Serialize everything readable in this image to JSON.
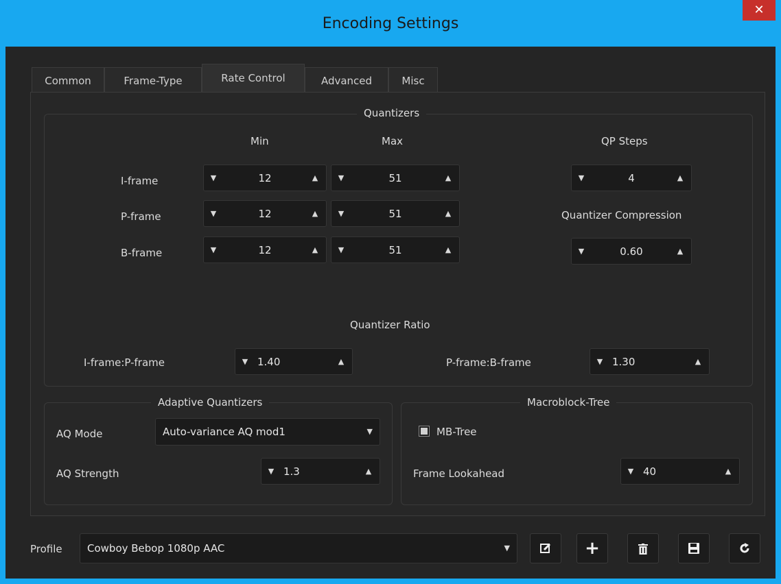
{
  "window": {
    "title": "Encoding Settings",
    "close_glyph": "✕"
  },
  "tabs": [
    {
      "label": "Common"
    },
    {
      "label": "Frame-Type"
    },
    {
      "label": "Rate Control",
      "active": true
    },
    {
      "label": "Advanced"
    },
    {
      "label": "Misc"
    }
  ],
  "quantizers": {
    "title": "Quantizers",
    "col_min": "Min",
    "col_max": "Max",
    "rows": [
      {
        "label": "I-frame",
        "min": "12",
        "max": "51"
      },
      {
        "label": "P-frame",
        "min": "12",
        "max": "51"
      },
      {
        "label": "B-frame",
        "min": "12",
        "max": "51"
      }
    ],
    "qp_steps_label": "QP Steps",
    "qp_steps": "4",
    "compression_label": "Quantizer Compression",
    "compression": "0.60",
    "ratio_title": "Quantizer Ratio",
    "ip_label": "I-frame:P-frame",
    "ip_value": "1.40",
    "pb_label": "P-frame:B-frame",
    "pb_value": "1.30"
  },
  "adaptive": {
    "title": "Adaptive Quantizers",
    "mode_label": "AQ Mode",
    "mode_value": "Auto-variance AQ mod1",
    "strength_label": "AQ Strength",
    "strength_value": "1.3"
  },
  "mbtree": {
    "title": "Macroblock-Tree",
    "checkbox_label": "MB-Tree",
    "checked": true,
    "lookahead_label": "Frame Lookahead",
    "lookahead_value": "40"
  },
  "profile": {
    "label": "Profile",
    "value": "Cowboy Bebop 1080p AAC"
  },
  "glyphs": {
    "spin_down": "▼",
    "spin_up": "▲",
    "dropdown": "▼",
    "add": "+"
  },
  "colors": {
    "titlebar": "#18a8f0",
    "close": "#c7302b",
    "background": "#252525"
  }
}
